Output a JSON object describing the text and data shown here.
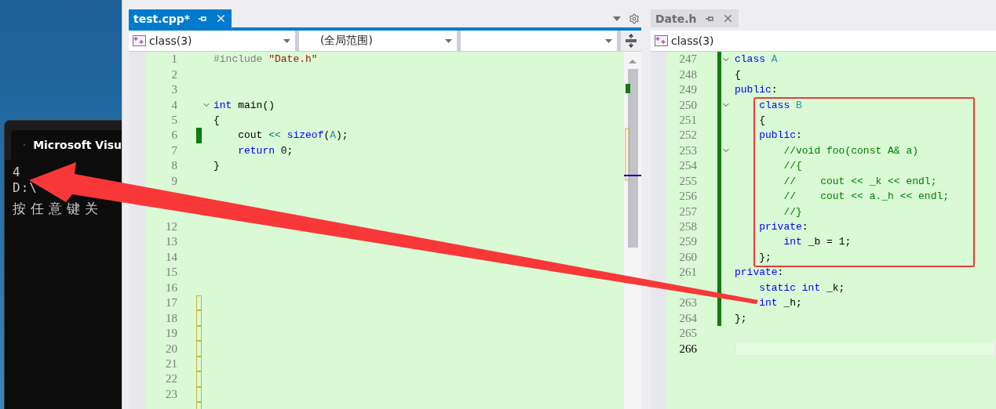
{
  "console": {
    "title": "Microsoft Visu",
    "lines": [
      "4",
      "D:\\",
      "按任意键关"
    ]
  },
  "editors": [
    {
      "tab": {
        "label": "test.cpp*",
        "selected": true
      },
      "tools": true,
      "dropdowns": [
        {
          "kind": "class",
          "value": "class(3)"
        },
        {
          "kind": "plain",
          "value": "(全局范围)"
        },
        {
          "kind": "plain"
        }
      ],
      "scrollbar": true,
      "lines": [
        {
          "n": "1",
          "code": [
            {
              "kind": "preprocessor",
              "text": "#include "
            },
            {
              "kind": "string",
              "text": "\"Date.h\""
            }
          ]
        },
        {
          "n": "2"
        },
        {
          "n": "3"
        },
        {
          "n": "4",
          "fold": true,
          "code": [
            {
              "kind": "keyword",
              "text": "int"
            },
            {
              "kind": "plain",
              "text": " main()"
            }
          ]
        },
        {
          "n": "5",
          "code": [
            {
              "kind": "plain",
              "text": "{"
            }
          ]
        },
        {
          "n": "6",
          "changed": true,
          "code": [
            {
              "kind": "plain",
              "text": "    cout "
            },
            {
              "kind": "operator",
              "text": "<<"
            },
            {
              "kind": "keyword",
              "text": " sizeof"
            },
            {
              "kind": "plain",
              "text": "("
            },
            {
              "kind": "type",
              "text": "A"
            },
            {
              "kind": "plain",
              "text": ");"
            }
          ]
        },
        {
          "n": "7",
          "code": [
            {
              "kind": "keyword",
              "text": "    return"
            },
            {
              "kind": "plain",
              "text": " 0;"
            }
          ]
        },
        {
          "n": "8",
          "code": [
            {
              "kind": "plain",
              "text": "}"
            }
          ]
        },
        {
          "n": "9"
        },
        {
          "unsaved": false
        },
        {
          "unsaved": false
        },
        {
          "n": "12"
        },
        {
          "n": "13"
        },
        {
          "n": "14"
        },
        {
          "n": "15"
        },
        {
          "n": "16"
        },
        {
          "n": "17",
          "unsaved": true
        },
        {
          "n": "18",
          "unsaved": true
        },
        {
          "n": "19",
          "unsaved": true
        },
        {
          "n": "20",
          "unsaved": true
        },
        {
          "n": "21",
          "unsaved": true
        },
        {
          "n": "22",
          "unsaved": true
        },
        {
          "n": "23",
          "unsaved": true
        },
        {
          "unsaved": true
        }
      ]
    },
    {
      "tab": {
        "label": "Date.h",
        "selected": false
      },
      "dropdowns": [
        {
          "kind": "class",
          "value": "class(3)"
        }
      ],
      "lines": [
        {
          "n": "247",
          "changed": true,
          "fold": true,
          "code": [
            {
              "kind": "keyword",
              "text": "class"
            },
            {
              "kind": "type",
              "text": " A"
            }
          ]
        },
        {
          "n": "248",
          "changed": true,
          "code": [
            {
              "kind": "plain",
              "text": "{"
            }
          ]
        },
        {
          "n": "249",
          "changed": true,
          "code": [
            {
              "kind": "keyword",
              "text": "public"
            },
            {
              "kind": "plain",
              "text": ":"
            }
          ]
        },
        {
          "n": "250",
          "changed": true,
          "fold": true,
          "code": [
            {
              "kind": "keyword",
              "text": "    class"
            },
            {
              "kind": "type",
              "text": " B"
            }
          ]
        },
        {
          "n": "251",
          "changed": true,
          "code": [
            {
              "kind": "plain",
              "text": "    {"
            }
          ]
        },
        {
          "n": "252",
          "changed": true,
          "code": [
            {
              "kind": "keyword",
              "text": "    public"
            },
            {
              "kind": "plain",
              "text": ":"
            }
          ]
        },
        {
          "n": "253",
          "changed": true,
          "fold": true,
          "code": [
            {
              "kind": "comment",
              "text": "        //void foo(const A& a)"
            }
          ]
        },
        {
          "n": "254",
          "changed": true,
          "code": [
            {
              "kind": "comment",
              "text": "        //{"
            }
          ]
        },
        {
          "n": "255",
          "changed": true,
          "code": [
            {
              "kind": "comment",
              "text": "        //    cout << _k << endl;"
            }
          ]
        },
        {
          "n": "256",
          "changed": true,
          "code": [
            {
              "kind": "comment",
              "text": "        //    cout << a._h << endl;"
            }
          ]
        },
        {
          "n": "257",
          "changed": true,
          "code": [
            {
              "kind": "comment",
              "text": "        //}"
            }
          ]
        },
        {
          "n": "258",
          "changed": true,
          "code": [
            {
              "kind": "keyword",
              "text": "    private"
            },
            {
              "kind": "plain",
              "text": ":"
            }
          ]
        },
        {
          "n": "259",
          "changed": true,
          "code": [
            {
              "kind": "keyword",
              "text": "        int"
            },
            {
              "kind": "plain",
              "text": " _b = 1;"
            }
          ]
        },
        {
          "n": "260",
          "changed": true,
          "code": [
            {
              "kind": "plain",
              "text": "    };"
            }
          ]
        },
        {
          "n": "261",
          "changed": true,
          "code": [
            {
              "kind": "keyword",
              "text": "private"
            },
            {
              "kind": "plain",
              "text": ":"
            }
          ]
        },
        {
          "changed": true,
          "code": [
            {
              "kind": "keyword",
              "text": "    static int"
            },
            {
              "kind": "plain",
              "text": " _k;"
            }
          ]
        },
        {
          "n": "263",
          "changed": true,
          "code": [
            {
              "kind": "keyword",
              "text": "    int"
            },
            {
              "kind": "plain",
              "text": " _h;"
            }
          ]
        },
        {
          "n": "264",
          "changed": true,
          "code": [
            {
              "kind": "plain",
              "text": "};"
            }
          ]
        },
        {
          "n": "265"
        },
        {
          "n": "266",
          "current": true
        }
      ]
    }
  ]
}
